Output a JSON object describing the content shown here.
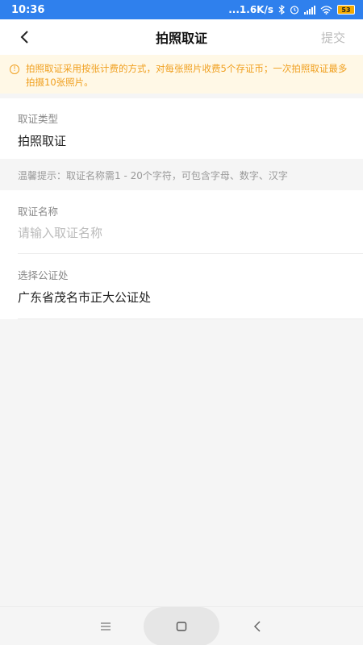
{
  "status_bar": {
    "time": "10:36",
    "network_speed": "...1.6K/s",
    "battery_level": "53"
  },
  "header": {
    "title": "拍照取证",
    "submit_label": "提交"
  },
  "notice": {
    "text": "拍照取证采用按张计费的方式，对每张照片收费5个存证币；一次拍照取证最多拍摄10张照片。"
  },
  "evidence_type": {
    "label": "取证类型",
    "value": "拍照取证"
  },
  "tip": "温馨提示：取证名称需1 - 20个字符，可包含字母、数字、汉字",
  "evidence_name": {
    "label": "取证名称",
    "placeholder": "请输入取证名称",
    "value": ""
  },
  "notary_office": {
    "label": "选择公证处",
    "value": "广东省茂名市正大公证处"
  },
  "colors": {
    "status_bar": "#2f80ed",
    "notice_bg": "#fff8e6",
    "notice_text": "#f0a020"
  },
  "icons": {
    "back": "chevron-left-icon",
    "notice": "info-icon",
    "nav_menu": "menu-icon",
    "nav_home": "square-icon",
    "nav_back": "chevron-left-icon"
  }
}
